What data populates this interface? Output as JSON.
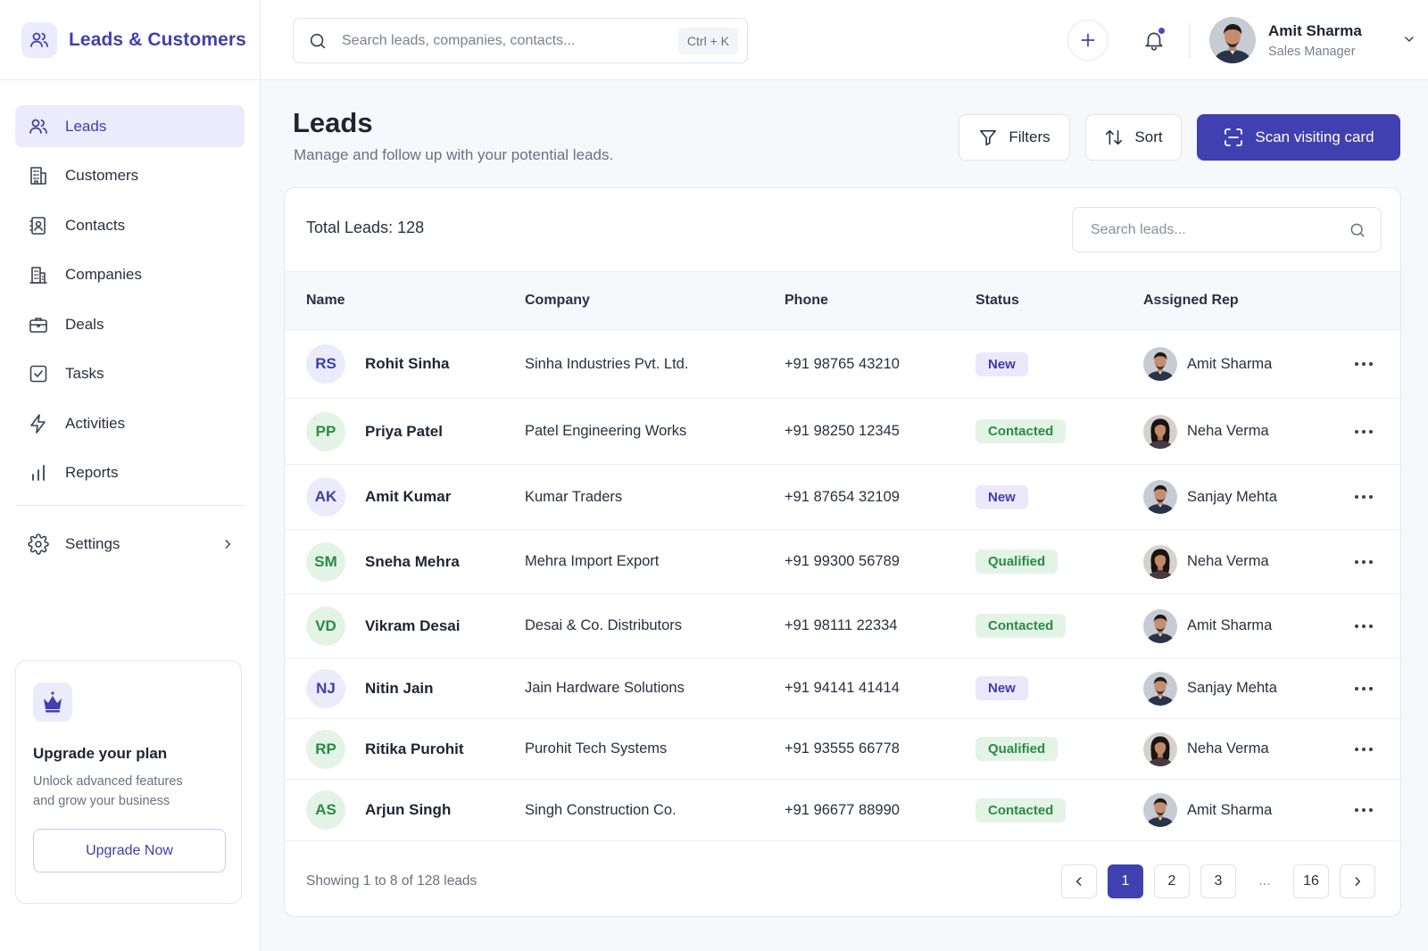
{
  "app": {
    "title": "Leads & Customers",
    "accent": "#4040b0"
  },
  "sidebar": {
    "items": [
      {
        "label": "Leads",
        "icon": "users-icon"
      },
      {
        "label": "Customers",
        "icon": "building-icon"
      },
      {
        "label": "Contacts",
        "icon": "contact-card-icon"
      },
      {
        "label": "Companies",
        "icon": "office-building-icon"
      },
      {
        "label": "Deals",
        "icon": "briefcase-icon"
      },
      {
        "label": "Tasks",
        "icon": "checkbox-icon"
      },
      {
        "label": "Activities",
        "icon": "bolt-icon"
      },
      {
        "label": "Reports",
        "icon": "bar-chart-icon"
      }
    ],
    "settings_label": "Settings",
    "upgrade": {
      "title": "Upgrade your plan",
      "description": "Unlock advanced features and grow your business",
      "button": "Upgrade Now"
    }
  },
  "topbar": {
    "search_placeholder": "Search leads, companies, contacts...",
    "shortcut": "Ctrl + K",
    "user": {
      "name": "Amit Sharma",
      "role": "Sales Manager"
    }
  },
  "page": {
    "title": "Leads",
    "subtitle": "Manage and follow up with your potential leads.",
    "filters_label": "Filters",
    "sort_label": "Sort",
    "scan_label": "Scan visiting card"
  },
  "table": {
    "total": "Total Leads: 128",
    "search_placeholder": "Search leads...",
    "columns": [
      "Name",
      "Company",
      "Phone",
      "Status",
      "Assigned Rep"
    ],
    "rows": [
      {
        "initials": "RS",
        "name": "Rohit Sinha",
        "company": "Sinha Industries Pvt. Ltd.",
        "phone": "+91 98765 43210",
        "status": "New",
        "rep": "Amit Sharma",
        "rep_gender": "m"
      },
      {
        "initials": "PP",
        "name": "Priya Patel",
        "company": "Patel Engineering Works",
        "phone": "+91 98250 12345",
        "status": "Contacted",
        "rep": "Neha Verma",
        "rep_gender": "f"
      },
      {
        "initials": "AK",
        "name": "Amit Kumar",
        "company": "Kumar Traders",
        "phone": "+91 87654 32109",
        "status": "New",
        "rep": "Sanjay Mehta",
        "rep_gender": "m"
      },
      {
        "initials": "SM",
        "name": "Sneha Mehra",
        "company": "Mehra Import Export",
        "phone": "+91 99300 56789",
        "status": "Qualified",
        "rep": "Neha Verma",
        "rep_gender": "f"
      },
      {
        "initials": "VD",
        "name": "Vikram Desai",
        "company": "Desai & Co. Distributors",
        "phone": "+91 98111 22334",
        "status": "Contacted",
        "rep": "Amit Sharma",
        "rep_gender": "m"
      },
      {
        "initials": "NJ",
        "name": "Nitin Jain",
        "company": "Jain Hardware Solutions",
        "phone": "+91 94141 41414",
        "status": "New",
        "rep": "Sanjay Mehta",
        "rep_gender": "m"
      },
      {
        "initials": "RP",
        "name": "Ritika Purohit",
        "company": "Purohit Tech Systems",
        "phone": "+91 93555 66778",
        "status": "Qualified",
        "rep": "Neha Verma",
        "rep_gender": "f"
      },
      {
        "initials": "AS",
        "name": "Arjun Singh",
        "company": "Singh Construction Co.",
        "phone": "+91 96677 88990",
        "status": "Contacted",
        "rep": "Amit Sharma",
        "rep_gender": "m"
      }
    ],
    "footer": "Showing 1 to 8 of 128 leads",
    "pages": [
      "1",
      "2",
      "3",
      "...",
      "16"
    ],
    "current_page": "1"
  },
  "status_colors": {
    "New": {
      "bg": "#ebe8fb",
      "fg": "#3d3da8"
    },
    "Contacted": {
      "bg": "#e3f4e7",
      "fg": "#2b8a45"
    },
    "Qualified": {
      "bg": "#e3f4e7",
      "fg": "#2b8a45"
    }
  },
  "initials_colors": {
    "purple": {
      "bg": "#ecebfb",
      "fg": "#3d3da8"
    },
    "green": {
      "bg": "#e3f4e7",
      "fg": "#2b8a45"
    }
  }
}
